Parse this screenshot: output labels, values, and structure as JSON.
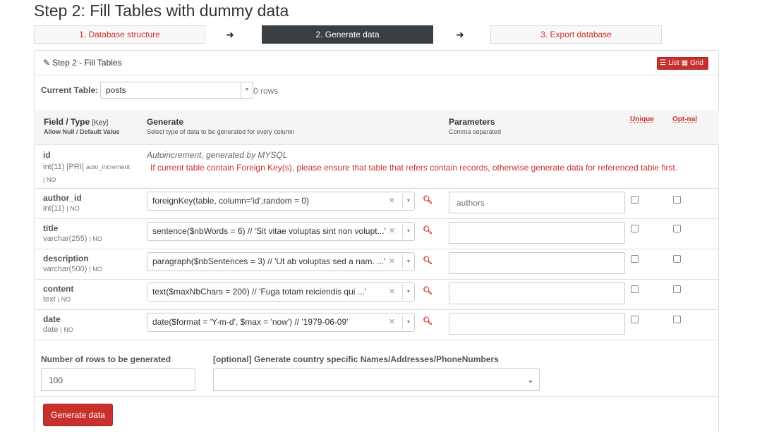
{
  "page": {
    "title": "Step 2: Fill Tables with dummy data"
  },
  "steps": [
    {
      "label": "1. Database structure"
    },
    {
      "label": "2. Generate data"
    },
    {
      "label": "3. Export database"
    }
  ],
  "arrow_glyph": "➜",
  "panel": {
    "heading": "Step 2 - Fill Tables",
    "heading_icon": "edit-icon",
    "view_list": "List",
    "view_grid": "Grid"
  },
  "current_table": {
    "label": "Current Table:",
    "value": "posts",
    "rows": "0 rows"
  },
  "columns": {
    "field": "Field / Type",
    "key": "[Key]",
    "field_sub": "Allow Null / Default Value",
    "generate": "Generate",
    "generate_sub": "Select type of data to be generated for every column",
    "parameters": "Parameters",
    "parameters_sub": "Comma separated",
    "unique": "Unique",
    "optnal": "Opt-nal"
  },
  "id_row": {
    "name": "id",
    "type": "int(11) [PRI]",
    "extra": "auto_increment",
    "null": "| NO",
    "note": "Autoincrement, generated by MYSQL",
    "warning": "If current table contain Foreign Key(s), please ensure that table that refers contain records, otherwise generate data for referenced table first."
  },
  "fields": [
    {
      "name": "author_id",
      "type": "int(11)",
      "null": "| NO",
      "generator": "foreignKey(table, column='id',random = 0)",
      "param": "authors"
    },
    {
      "name": "title",
      "type": "varchar(255)",
      "null": "| NO",
      "generator": "sentence($nbWords = 6) // 'Sit vitae voluptas sint non volupt...'",
      "param": ""
    },
    {
      "name": "description",
      "type": "varchar(500)",
      "null": "| NO",
      "generator": "paragraph($nbSentences = 3) // 'Ut ab voluptas sed a nam. ...'",
      "param": ""
    },
    {
      "name": "content",
      "type": "text",
      "null": "| NO",
      "generator": "text($maxNbChars = 200) // 'Fuga totam reiciendis qui ...'",
      "param": ""
    },
    {
      "name": "date",
      "type": "date",
      "null": "| NO",
      "generator": "date($format = 'Y-m-d', $max = 'now') // '1979-06-09'",
      "param": ""
    }
  ],
  "footer_form": {
    "rows_label": "Number of rows to be generated",
    "rows_value": "100",
    "country_label": "[optional] Generate country specific Names/Addresses/PhoneNumbers",
    "country_value": ""
  },
  "generate_button": "Generate data",
  "colors": {
    "accent": "#c9302c",
    "active_step": "#3a3f44"
  }
}
